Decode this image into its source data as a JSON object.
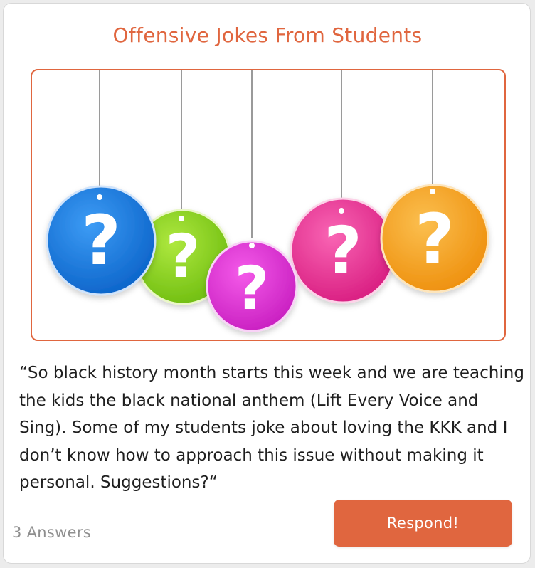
{
  "post": {
    "title": "Offensive Jokes From Students",
    "body": "“So black history month starts this week and we are teaching the kids the black national anthem (Lift Every Voice and Sing). Some of my students joke about loving the KKK and I don’t know how to approach this issue without making it personal. Suggestions?“",
    "image_icons": [
      "question-mark-tag-blue",
      "question-mark-tag-green",
      "question-mark-tag-magenta",
      "question-mark-tag-pink",
      "question-mark-tag-orange"
    ]
  },
  "footer": {
    "answers_label": "3 Answers",
    "respond_label": "Respond!"
  },
  "colors": {
    "accent": "#e0663f",
    "tag_blue": "#1e7fe0",
    "tag_green": "#8fd41c",
    "tag_magenta": "#e52cdc",
    "tag_pink": "#f0359a",
    "tag_orange": "#f7a21e"
  }
}
